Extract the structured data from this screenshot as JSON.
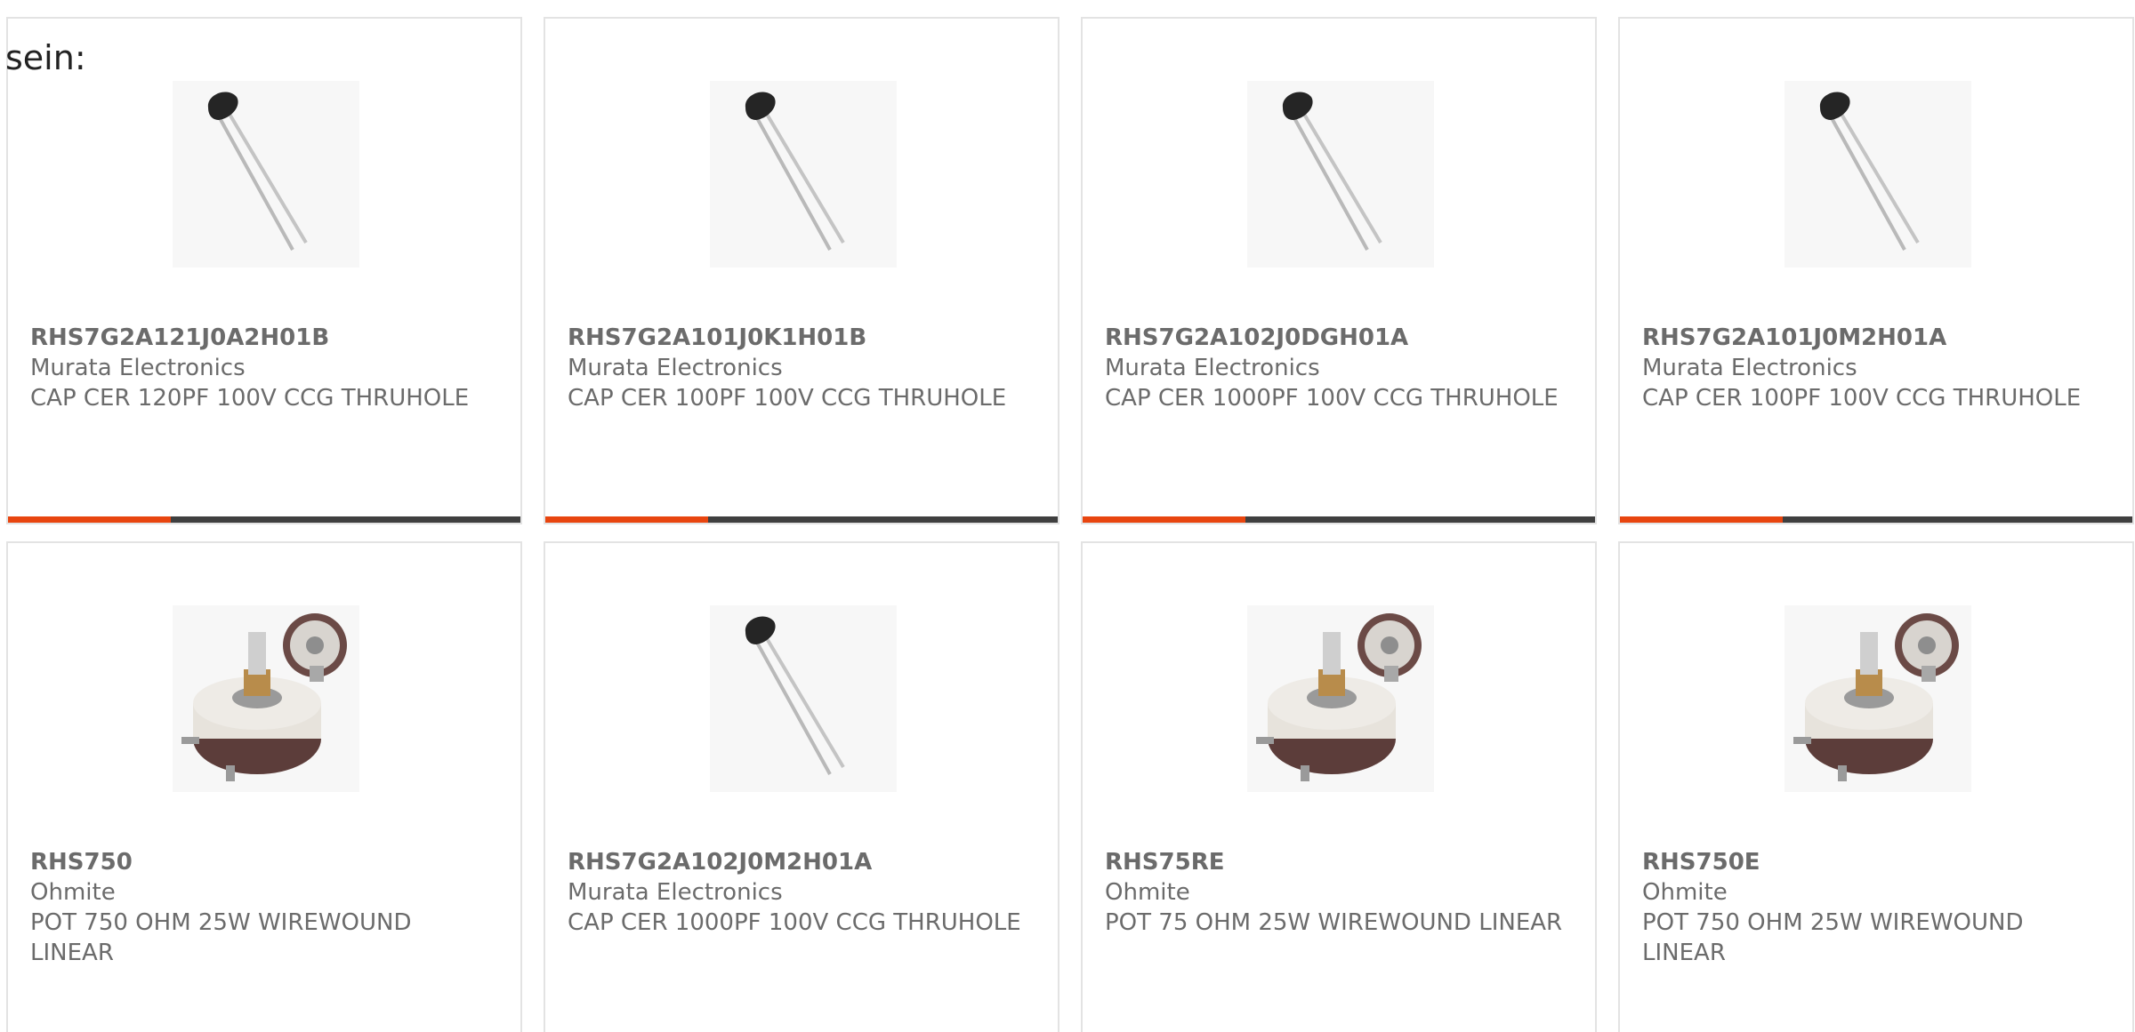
{
  "intro_text": "sein:",
  "colors": {
    "accent": "#e8450f",
    "bar": "#3f3f3f",
    "text": "#6b6b6b",
    "border": "#e3e3e3"
  },
  "products": [
    {
      "part_number": "RHS7G2A121J0A2H01B",
      "manufacturer": "Murata Electronics",
      "description": "CAP CER 120PF 100V CCG THRUHOLE",
      "image": "ceramic-capacitor-image"
    },
    {
      "part_number": "RHS7G2A101J0K1H01B",
      "manufacturer": "Murata Electronics",
      "description": "CAP CER 100PF 100V CCG THRUHOLE",
      "image": "ceramic-capacitor-image"
    },
    {
      "part_number": "RHS7G2A102J0DGH01A",
      "manufacturer": "Murata Electronics",
      "description": "CAP CER 1000PF 100V CCG THRUHOLE",
      "image": "ceramic-capacitor-image"
    },
    {
      "part_number": "RHS7G2A101J0M2H01A",
      "manufacturer": "Murata Electronics",
      "description": "CAP CER 100PF 100V CCG THRUHOLE",
      "image": "ceramic-capacitor-image"
    },
    {
      "part_number": "RHS750",
      "manufacturer": "Ohmite",
      "description": "POT 750 OHM 25W WIREWOUND LINEAR",
      "image": "rheostat-potentiometer-image"
    },
    {
      "part_number": "RHS7G2A102J0M2H01A",
      "manufacturer": "Murata Electronics",
      "description": "CAP CER 1000PF 100V CCG THRUHOLE",
      "image": "ceramic-capacitor-image"
    },
    {
      "part_number": "RHS75RE",
      "manufacturer": "Ohmite",
      "description": "POT 75 OHM 25W WIREWOUND LINEAR",
      "image": "rheostat-potentiometer-image"
    },
    {
      "part_number": "RHS750E",
      "manufacturer": "Ohmite",
      "description": "POT 750 OHM 25W WIREWOUND LINEAR",
      "image": "rheostat-potentiometer-image"
    }
  ]
}
